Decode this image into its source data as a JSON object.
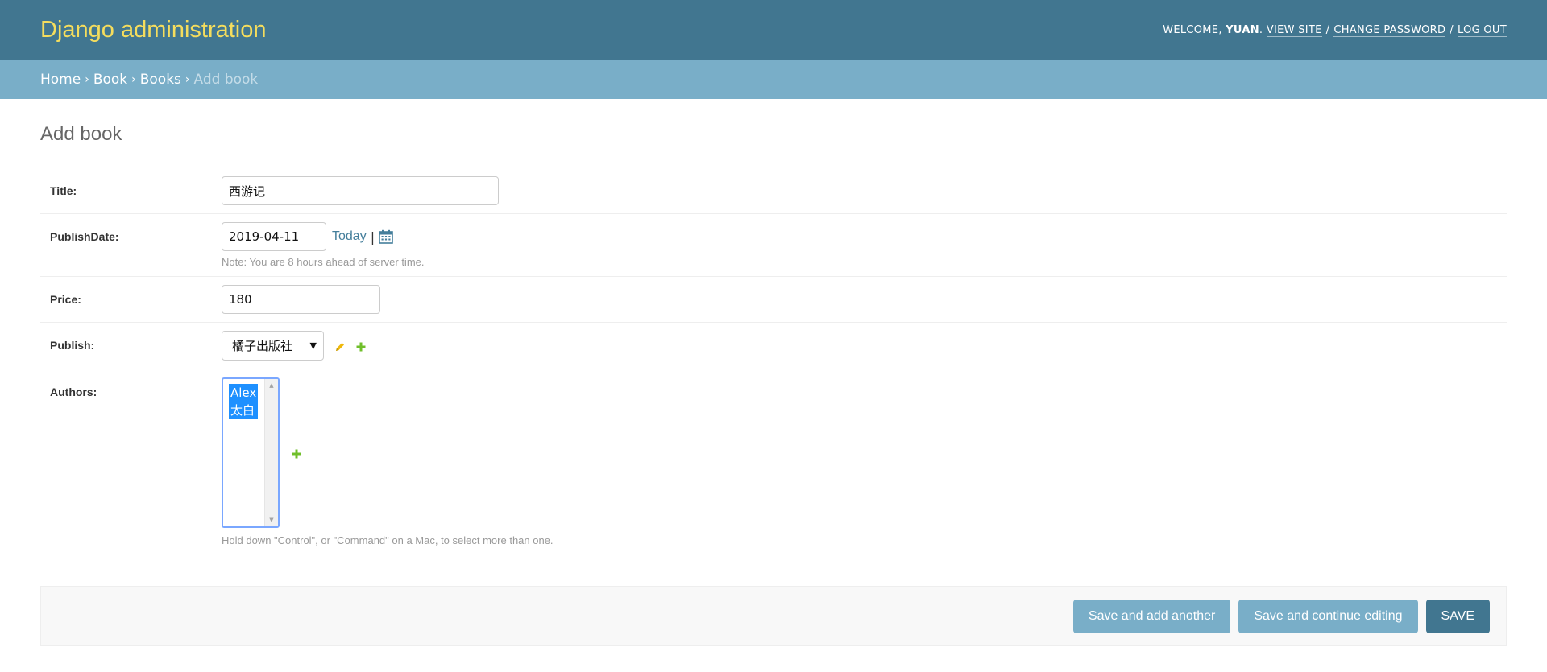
{
  "header": {
    "branding": "Django administration",
    "welcome_text": "WELCOME,",
    "username": "YUAN",
    "view_site": "VIEW SITE",
    "change_password": "CHANGE PASSWORD",
    "log_out": "LOG OUT",
    "separator": "/"
  },
  "breadcrumbs": {
    "items": [
      "Home",
      "Book",
      "Books"
    ],
    "current": "Add book",
    "arrow": "›"
  },
  "page": {
    "title": "Add book"
  },
  "form": {
    "title": {
      "label": "Title:",
      "value": "西游记"
    },
    "publish_date": {
      "label": "PublishDate:",
      "value": "2019-04-11",
      "today_link": "Today",
      "pipe": "|",
      "note": "Note: You are 8 hours ahead of server time."
    },
    "price": {
      "label": "Price:",
      "value": "180"
    },
    "publish": {
      "label": "Publish:",
      "selected": "橘子出版社",
      "arrow": "▼"
    },
    "authors": {
      "label": "Authors:",
      "options": [
        "Alex",
        "太白"
      ],
      "help": "Hold down \"Control\", or \"Command\" on a Mac, to select more than one."
    }
  },
  "submit": {
    "save_add_another": "Save and add another",
    "save_continue": "Save and continue editing",
    "save": "SAVE"
  },
  "colors": {
    "header_bg": "#417690",
    "branding": "#f5dd5d",
    "breadcrumbs_bg": "#79aec8",
    "button": "#79aec8",
    "button_default": "#417690",
    "link": "#447e9b",
    "add_icon": "#70bf2b",
    "change_icon": "#efb80b"
  },
  "icons": {
    "calendar": "calendar-icon",
    "change": "pencil-icon",
    "add": "plus-icon"
  }
}
